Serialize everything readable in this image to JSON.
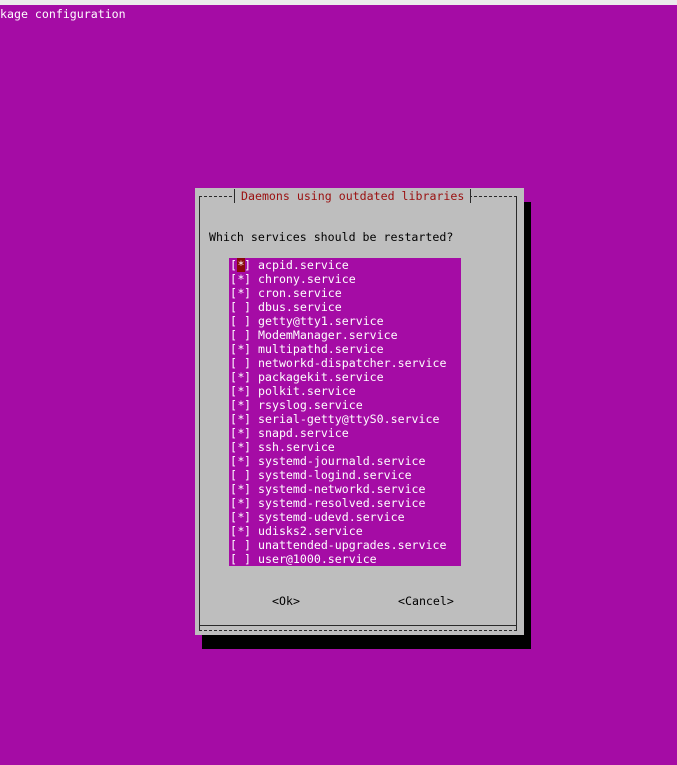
{
  "backtitle": "kage configuration",
  "dialog": {
    "title": "Daemons using outdated libraries",
    "prompt": "Which services should be restarted?"
  },
  "checkbox": {
    "open": "[",
    "close": "]",
    "checked_mark": "*",
    "unchecked_mark": " "
  },
  "services": [
    {
      "name": "acpid.service",
      "checked": true,
      "focused": true
    },
    {
      "name": "chrony.service",
      "checked": true
    },
    {
      "name": "cron.service",
      "checked": true
    },
    {
      "name": "dbus.service",
      "checked": false
    },
    {
      "name": "getty@tty1.service",
      "checked": false
    },
    {
      "name": "ModemManager.service",
      "checked": false
    },
    {
      "name": "multipathd.service",
      "checked": true
    },
    {
      "name": "networkd-dispatcher.service",
      "checked": false
    },
    {
      "name": "packagekit.service",
      "checked": true
    },
    {
      "name": "polkit.service",
      "checked": true
    },
    {
      "name": "rsyslog.service",
      "checked": true
    },
    {
      "name": "serial-getty@ttyS0.service",
      "checked": true
    },
    {
      "name": "snapd.service",
      "checked": true
    },
    {
      "name": "ssh.service",
      "checked": true
    },
    {
      "name": "systemd-journald.service",
      "checked": true
    },
    {
      "name": "systemd-logind.service",
      "checked": false
    },
    {
      "name": "systemd-networkd.service",
      "checked": true
    },
    {
      "name": "systemd-resolved.service",
      "checked": true
    },
    {
      "name": "systemd-udevd.service",
      "checked": true
    },
    {
      "name": "udisks2.service",
      "checked": true
    },
    {
      "name": "unattended-upgrades.service",
      "checked": false
    },
    {
      "name": "user@1000.service",
      "checked": false
    }
  ],
  "buttons": {
    "ok": "<Ok>",
    "cancel": "<Cancel>"
  },
  "colors": {
    "background": "#a50ca5",
    "dialog": "#bebebe",
    "title": "#9a1010",
    "cursor": "#8a0a0a"
  }
}
